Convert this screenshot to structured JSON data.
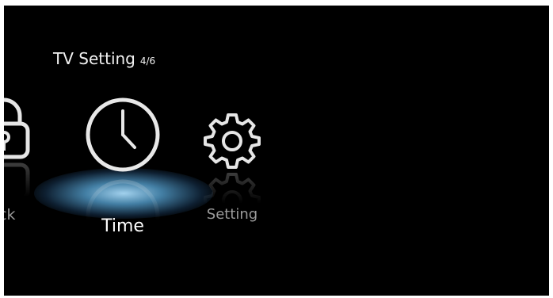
{
  "menu": {
    "title": "TV Setting",
    "page_indicator": "4/6"
  },
  "items": [
    {
      "label": "ock",
      "icon": "lock-icon",
      "selected": false
    },
    {
      "label": "Time",
      "icon": "clock-icon",
      "selected": true
    },
    {
      "label": "Setting",
      "icon": "gear-icon",
      "selected": false
    }
  ],
  "colors": {
    "background": "#000000",
    "text_selected": "#ffffff",
    "text_unselected": "#9a9a9a",
    "highlight_glow": "#7fc6ef"
  }
}
